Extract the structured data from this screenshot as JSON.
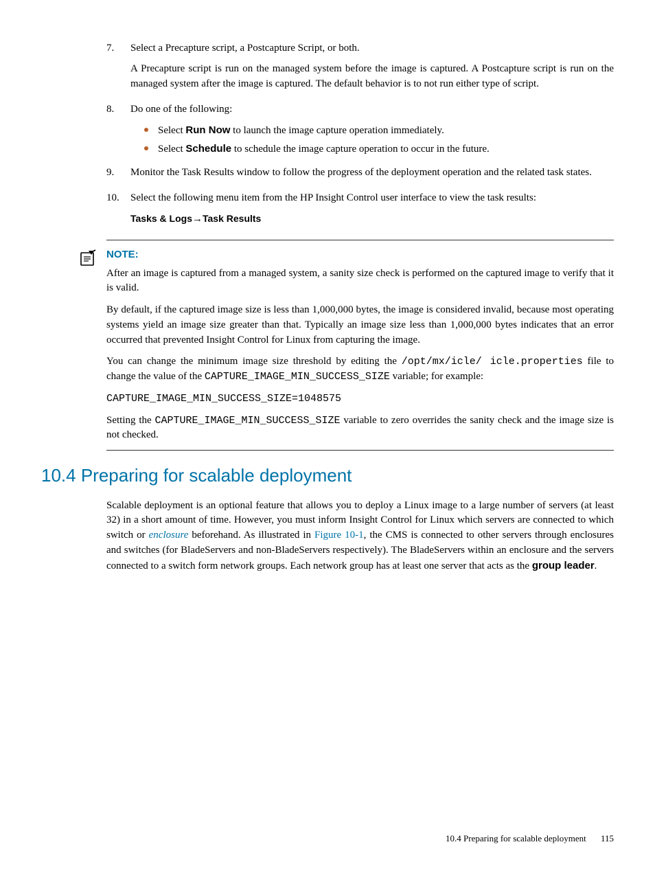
{
  "list": {
    "item7": {
      "num": "7.",
      "p1": "Select a Precapture script, a Postcapture Script, or both.",
      "p2": "A Precapture script is run on the managed system before the image is captured. A Postcapture script is run on the managed system after the image is captured. The default behavior is to not run either type of script."
    },
    "item8": {
      "num": "8.",
      "p1": "Do one of the following:",
      "b1_pre": "Select ",
      "b1_bold": "Run Now",
      "b1_post": " to launch the image capture operation immediately.",
      "b2_pre": "Select ",
      "b2_bold": "Schedule",
      "b2_post": " to schedule the image capture operation to occur in the future."
    },
    "item9": {
      "num": "9.",
      "p1": "Monitor the Task Results window to follow the progress of the deployment operation and the related task states."
    },
    "item10": {
      "num": "10.",
      "p1": "Select the following menu item from the HP Insight Control user interface to view the task results:",
      "path_a": "Tasks & Logs",
      "arrow": "→",
      "path_b": "Task Results"
    }
  },
  "note": {
    "label": "NOTE:",
    "p1": "After an image is captured from a managed system, a sanity size check is performed on the captured image to verify that it is valid.",
    "p2": "By default, if the captured image size is less than 1,000,000 bytes, the image is considered invalid, because most operating systems yield an image size greater than that. Typically an image size less than 1,000,000 bytes indicates that an error occurred that prevented Insight Control for Linux from capturing the image.",
    "p3_a": "You can change the minimum image size threshold by editing the ",
    "p3_code1": "/opt/mx/icle/ icle.properties",
    "p3_b": " file to change the value of the ",
    "p3_code2": "CAPTURE_IMAGE_MIN_SUCCESS_SIZE",
    "p3_c": " variable; for example:",
    "codeblock": "CAPTURE_IMAGE_MIN_SUCCESS_SIZE=1048575",
    "p4_a": "Setting the ",
    "p4_code": "CAPTURE_IMAGE_MIN_SUCCESS_SIZE",
    "p4_b": " variable to zero overrides the sanity check and the image size is not checked."
  },
  "section": {
    "heading": "10.4 Preparing for scalable deployment",
    "p1_a": "Scalable deployment is an optional feature that allows you to deploy a Linux image to a large number of servers (at least 32) in a short amount of time. However, you must inform Insight Control for Linux which servers are connected to which switch or ",
    "p1_link1": "enclosure",
    "p1_b": " beforehand. As illustrated in ",
    "p1_link2": "Figure 10-1",
    "p1_c": ", the CMS is connected to other servers through enclosures and switches (for BladeServers and non-BladeServers respectively). The BladeServers within an enclosure and the servers connected to a switch form network groups. Each network group has at least one server that acts as the ",
    "p1_bold": "group leader",
    "p1_d": "."
  },
  "footer": {
    "text": "10.4 Preparing for scalable deployment",
    "page": "115"
  }
}
